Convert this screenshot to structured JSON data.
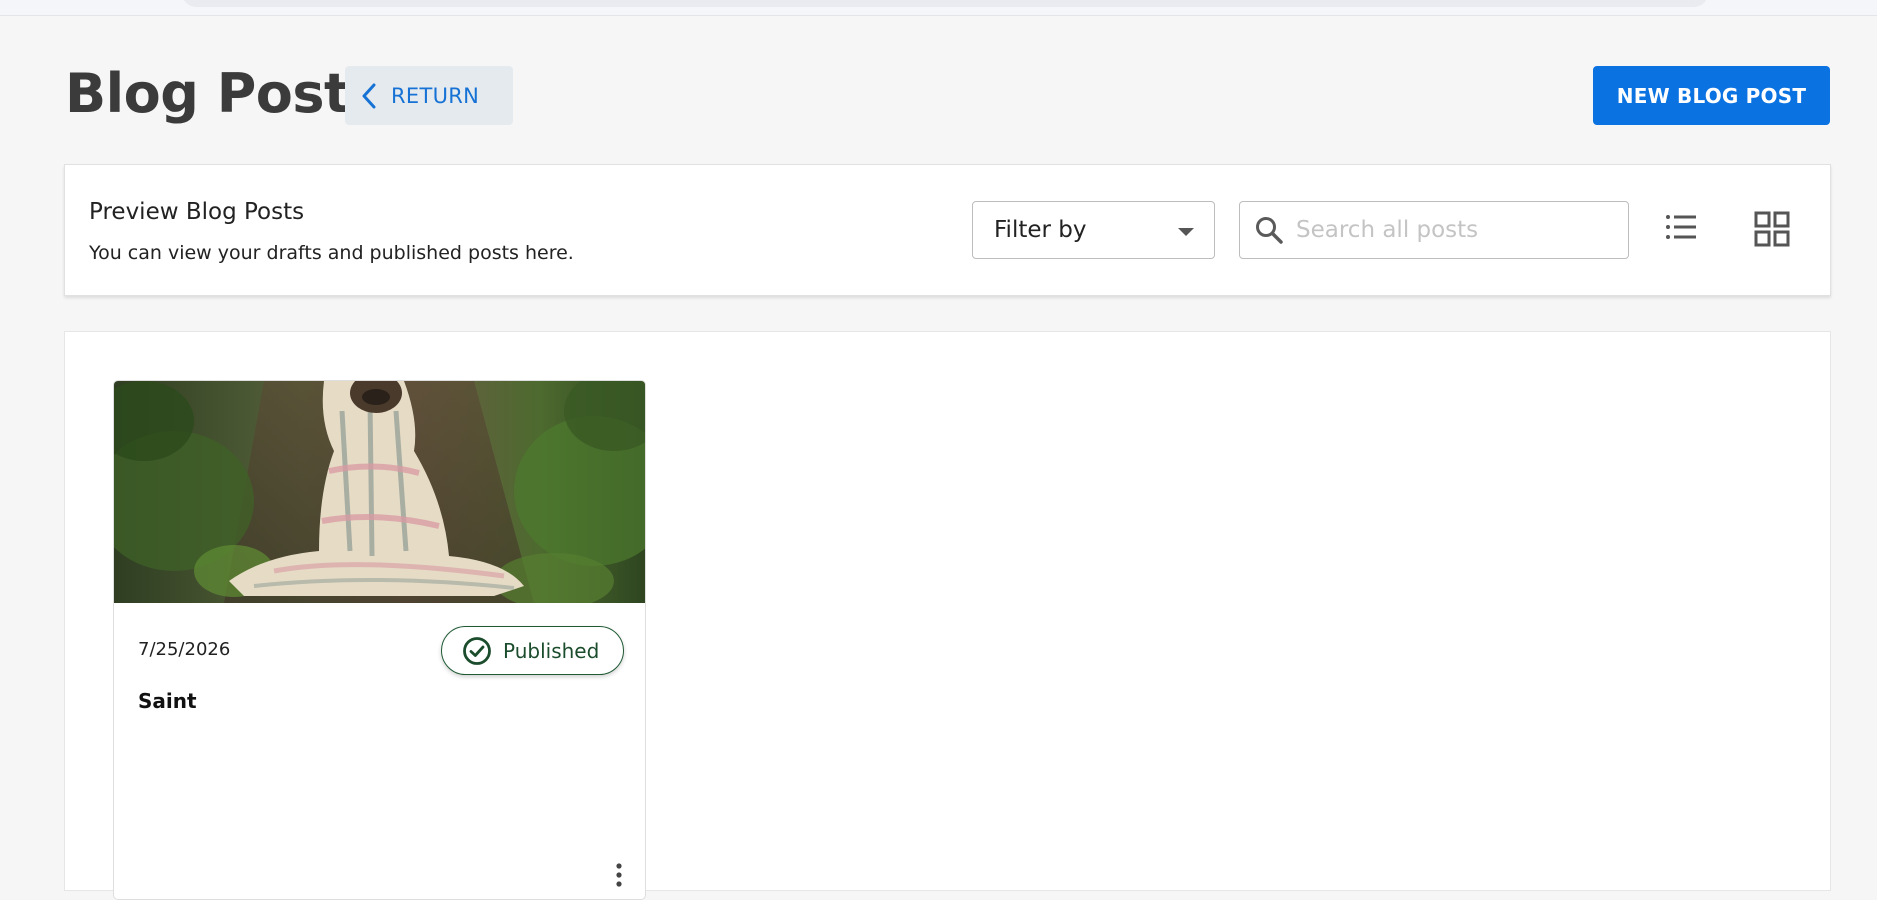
{
  "header": {
    "title": "Blog Post",
    "return_label": "RETURN",
    "new_post_label": "NEW BLOG POST"
  },
  "preview": {
    "title": "Preview Blog Posts",
    "subtitle": "You can view your drafts and published posts here.",
    "filter": {
      "selected": "Filter by"
    },
    "search": {
      "placeholder": "Search all posts",
      "value": ""
    }
  },
  "posts": [
    {
      "date": "7/25/2026",
      "status": "Published",
      "title": "Saint",
      "image": "pug-wrapped-in-blanket-photo"
    }
  ],
  "icons": {
    "return": "chevron-left-icon",
    "search": "search-icon",
    "list_view": "list-view-icon",
    "grid_view": "grid-view-icon",
    "status": "check-circle-icon",
    "more": "more-vertical-icon"
  },
  "colors": {
    "primary": "#0a72e1",
    "return_bg": "#e5eaef",
    "published": "#1b4d2d",
    "page_bg": "#f6f6f6"
  }
}
